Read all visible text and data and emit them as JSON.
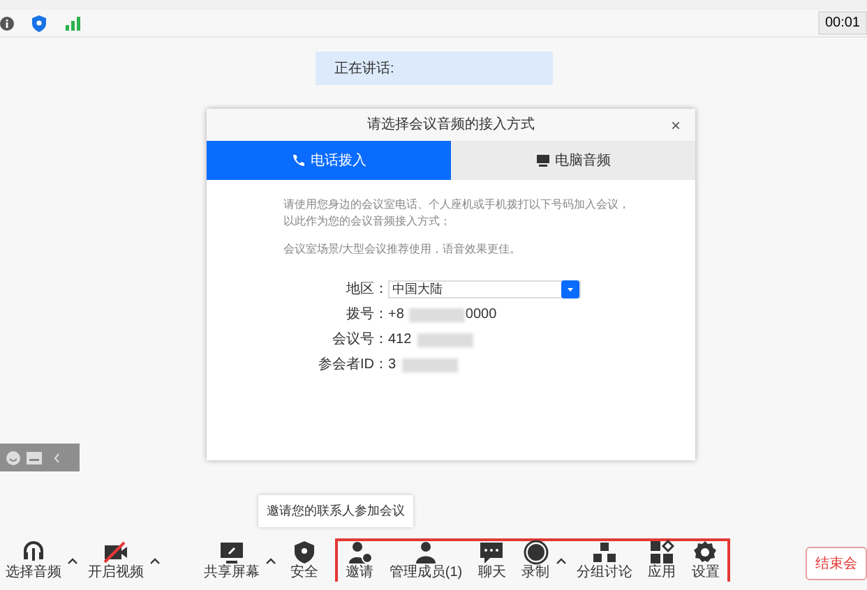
{
  "status_bar": {
    "timer": "00:01"
  },
  "speaking": {
    "label": "正在讲话:"
  },
  "dialog": {
    "title": "请选择会议音频的接入方式",
    "close": "×",
    "tabs": [
      {
        "label": "电话拨入",
        "kind": "phone",
        "selected": true
      },
      {
        "label": "电脑音频",
        "kind": "computer",
        "selected": false
      }
    ],
    "instructions": [
      "请使用您身边的会议室电话、个人座机或手机拨打以下号码加入会议，以此作为您的会议音频接入方式；",
      "会议室场景/大型会议推荐使用，语音效果更佳。"
    ],
    "fields": [
      {
        "kind": "select",
        "label": "地区：",
        "value": "中国大陆"
      },
      {
        "kind": "text",
        "label": "拨号：",
        "value": "+8",
        "value_end": "0000"
      },
      {
        "kind": "text",
        "label": "会议号：",
        "value": "412"
      },
      {
        "kind": "text",
        "label": "参会者ID：",
        "value": "3"
      }
    ]
  },
  "tooltip": "邀请您的联系人参加会议",
  "toolbar": {
    "left": [
      {
        "kind": "headset",
        "label": "选择音频",
        "caret": true
      },
      {
        "kind": "camera-off",
        "label": "开启视频",
        "caret": true
      }
    ],
    "middle": [
      {
        "kind": "screen",
        "label": "共享屏幕",
        "caret": true
      },
      {
        "kind": "shield",
        "label": "安全",
        "caret": false
      }
    ],
    "highlighted": [
      {
        "kind": "invite",
        "label": "邀请",
        "caret": false
      },
      {
        "kind": "members",
        "label": "管理成员(1)",
        "caret": false
      },
      {
        "kind": "chat",
        "label": "聊天",
        "caret": false
      },
      {
        "kind": "record",
        "label": "录制",
        "caret": true
      },
      {
        "kind": "groups",
        "label": "分组讨论",
        "caret": false
      },
      {
        "kind": "apps",
        "label": "应用",
        "caret": false
      },
      {
        "kind": "settings",
        "label": "设置",
        "caret": false
      }
    ]
  },
  "end_button": "结束会"
}
